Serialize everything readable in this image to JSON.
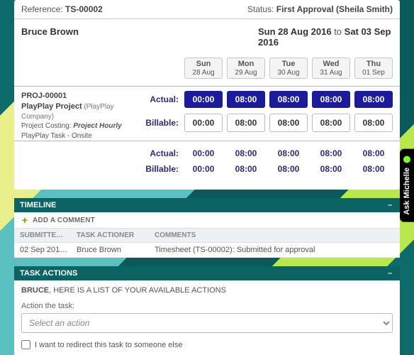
{
  "header": {
    "ref_label": "Reference:",
    "ref_value": "TS-00002",
    "status_label": "Status:",
    "status_value": "First Approval (Sheila Smith)",
    "person": "Bruce Brown",
    "range_start": "Sun 28 Aug 2016",
    "range_to": "to",
    "range_end": "Sat 03 Sep 2016"
  },
  "days": [
    {
      "name": "Sun",
      "date": "28 Aug"
    },
    {
      "name": "Mon",
      "date": "29 Aug"
    },
    {
      "name": "Tue",
      "date": "30 Aug"
    },
    {
      "name": "Wed",
      "date": "31 Aug"
    },
    {
      "name": "Thu",
      "date": "01 Sep"
    }
  ],
  "project": {
    "code": "PROJ-00001",
    "name": "PlayPlay Project",
    "company": "(PlayPlay Company)",
    "costing_label": "Project Costing:",
    "costing_value": "Project Hourly",
    "task": "PlayPlay Task - Onsite"
  },
  "labels": {
    "actual": "Actual:",
    "billable": "Billable:"
  },
  "actual": [
    "00:00",
    "08:00",
    "08:00",
    "08:00",
    "08:00"
  ],
  "billable": [
    "00:00",
    "08:00",
    "08:00",
    "08:00",
    "08:00"
  ],
  "sum_actual": [
    "00:00",
    "08:00",
    "08:00",
    "08:00",
    "08:00"
  ],
  "sum_billable": [
    "00:00",
    "08:00",
    "08:00",
    "08:00",
    "08:00"
  ],
  "timeline": {
    "title": "TIMELINE",
    "add_comment": "ADD A COMMENT",
    "headers": {
      "submitted": "SUBMITTE…",
      "actioner": "TASK ACTIONER",
      "comments": "COMMENTS"
    },
    "rows": [
      {
        "submitted": "02 Sep 201…",
        "actioner": "Bruce Brown",
        "comments": "Timesheet (TS-00002): Submitted for approval"
      }
    ]
  },
  "actions": {
    "title": "TASK ACTIONS",
    "instruction_name": "BRUCE",
    "instruction_rest": ", HERE IS A LIST OF YOUR AVAILABLE ACTIONS",
    "field_label": "Action the task:",
    "placeholder": "Select an action",
    "redirect_label": "I want to redirect this task to someone else"
  },
  "ask": "Ask Michelle"
}
